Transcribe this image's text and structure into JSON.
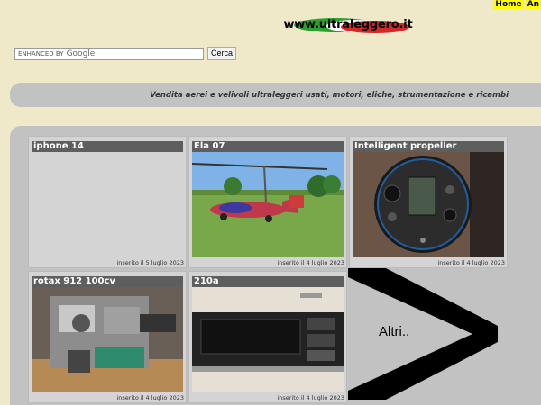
{
  "header": {
    "links": [
      "Home",
      "An"
    ],
    "logo_text": "www.ultraleggero.it"
  },
  "search": {
    "placeholder": "ENHANCED BY",
    "google_label": "Google",
    "button_label": "Cerca"
  },
  "banner": {
    "tagline": "Vendita aerei e velivoli ultraleggeri usati, motori, eliche, strumentazione e ricambi"
  },
  "listings": [
    {
      "title": "iphone 14",
      "date": "inserito il 5 luglio 2023",
      "image": "none"
    },
    {
      "title": "Ela 07",
      "date": "inserito il 4 luglio 2023",
      "image": "red autogyro on grass field"
    },
    {
      "title": "Intelligent propeller",
      "date": "inserito il 4 luglio 2023",
      "image": "propeller controller gauge"
    },
    {
      "title": "rotax 912 100cv",
      "date": "inserito il 4 luglio 2023",
      "image": "aircraft engine on pallet"
    },
    {
      "title": "210a",
      "date": "inserito il 4 luglio 2023",
      "image": "avionics radio unit"
    }
  ],
  "more": {
    "label": "Altri.."
  }
}
